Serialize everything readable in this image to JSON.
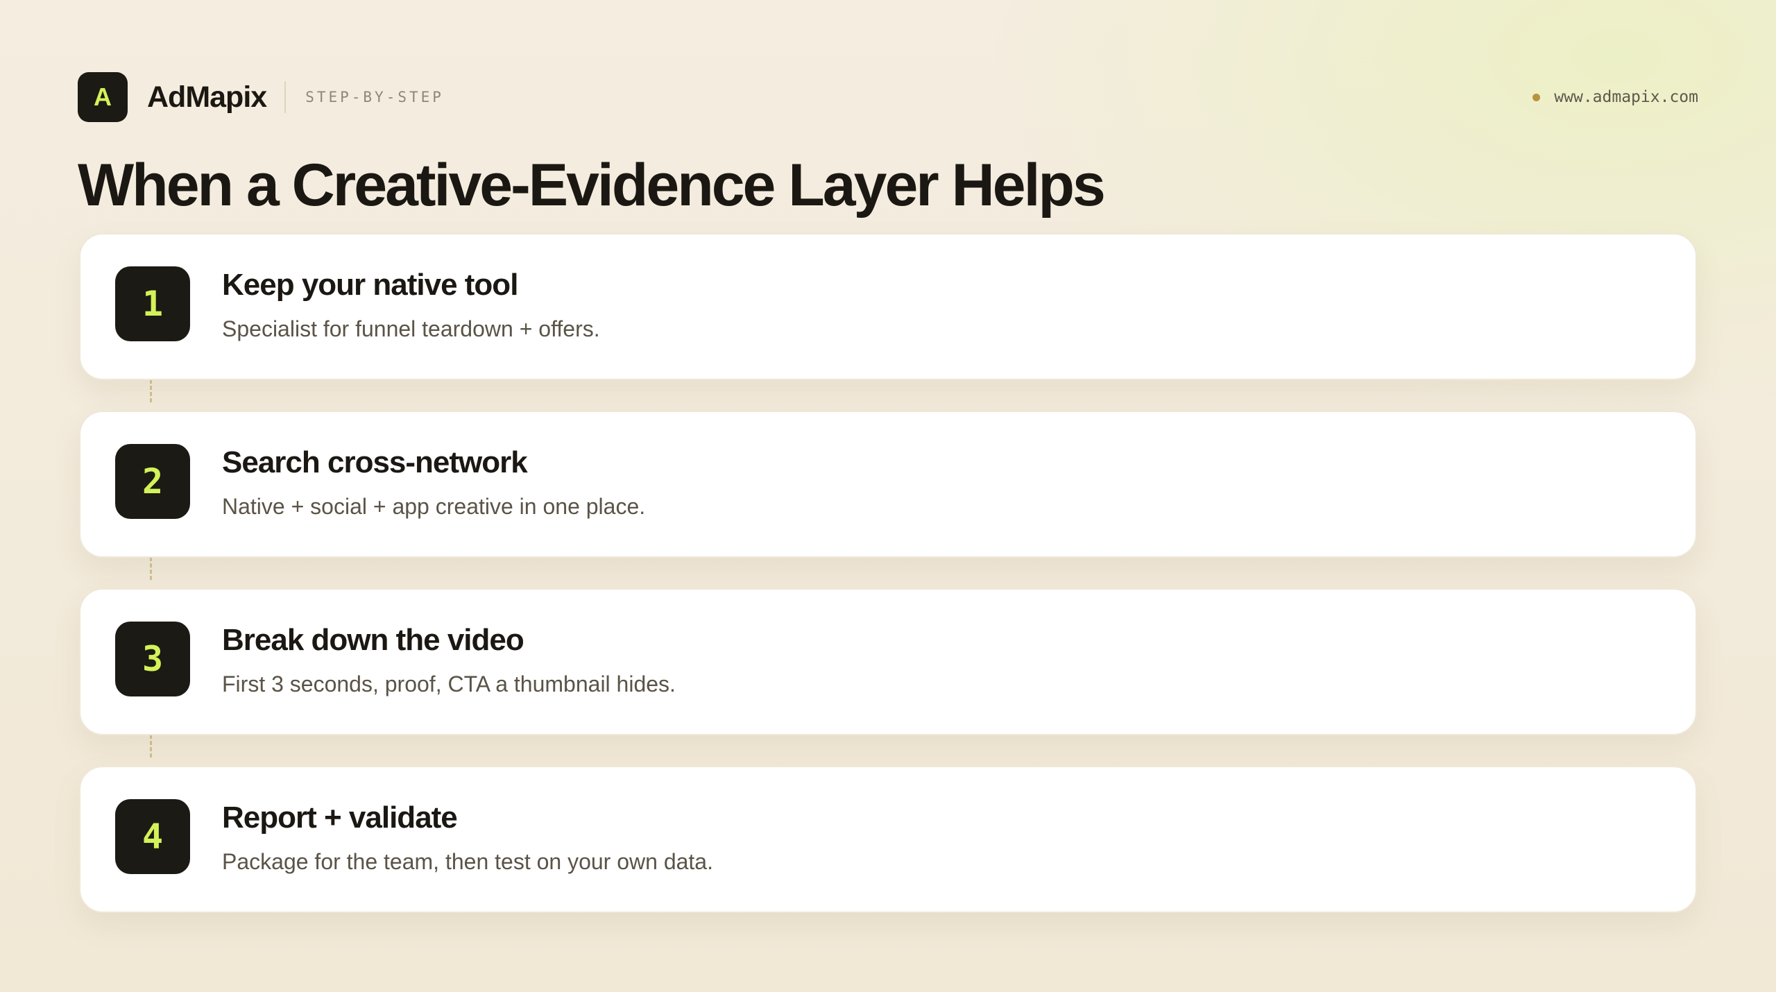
{
  "header": {
    "logo_letter": "A",
    "brand": "AdMapix",
    "tag": "STEP-BY-STEP",
    "url": "www.admapix.com"
  },
  "title": "When a Creative-Evidence Layer Helps",
  "steps": [
    {
      "number": "1",
      "title": "Keep your native tool",
      "description": "Specialist for funnel teardown + offers."
    },
    {
      "number": "2",
      "title": "Search cross-network",
      "description": "Native + social + app creative in one place."
    },
    {
      "number": "3",
      "title": "Break down the video",
      "description": "First 3 seconds, proof, CTA a thumbnail hides."
    },
    {
      "number": "4",
      "title": "Report + validate",
      "description": "Package for the team, then test on your own data."
    }
  ],
  "colors": {
    "accent": "#d3f25a",
    "badge": "#1c1a14",
    "dot": "#b8933f"
  }
}
